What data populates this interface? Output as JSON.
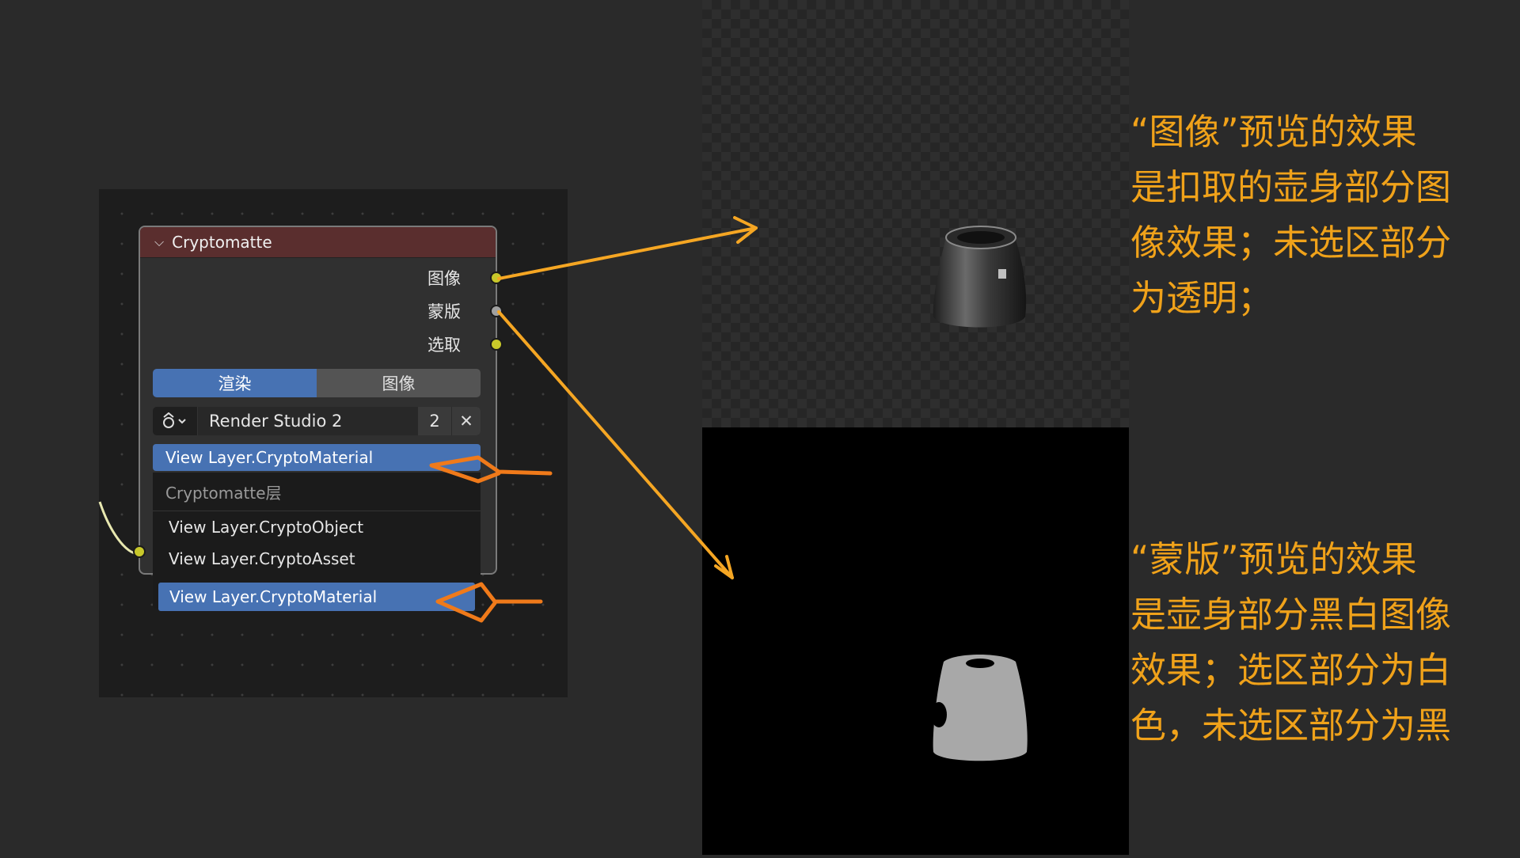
{
  "node": {
    "title": "Cryptomatte",
    "outputs": [
      "图像",
      "蒙版",
      "选取"
    ],
    "tabs": [
      "渲染",
      "图像"
    ],
    "scene_name": "Render Studio 2",
    "scene_count": "2",
    "layer_field": "View Layer.CryptoMaterial",
    "dropdown_header": "Cryptomatte层",
    "dropdown_items": [
      "View Layer.CryptoObject",
      "View Layer.CryptoAsset",
      "View Layer.CryptoMaterial"
    ]
  },
  "captions": {
    "top": [
      "“图像”预览的效果",
      "是扣取的壶身部分图",
      "像效果；未选区部分",
      "为透明；"
    ],
    "bottom": [
      "“蒙版”预览的效果",
      "是壶身部分黑白图像",
      "效果；选区部分为白",
      "色，未选区部分为黑"
    ]
  },
  "colors": {
    "socket_yellow": "#c8c82a",
    "socket_gray": "#a0a0a0",
    "arrow_yellow": "#f5a623",
    "arrow_orange": "#f07a1a",
    "caption": "#f0a21a",
    "accent_blue": "#4772b3",
    "header_red": "#5a2e2e"
  },
  "icons": [
    "chevron-down-icon",
    "scene-icon",
    "close-icon"
  ]
}
